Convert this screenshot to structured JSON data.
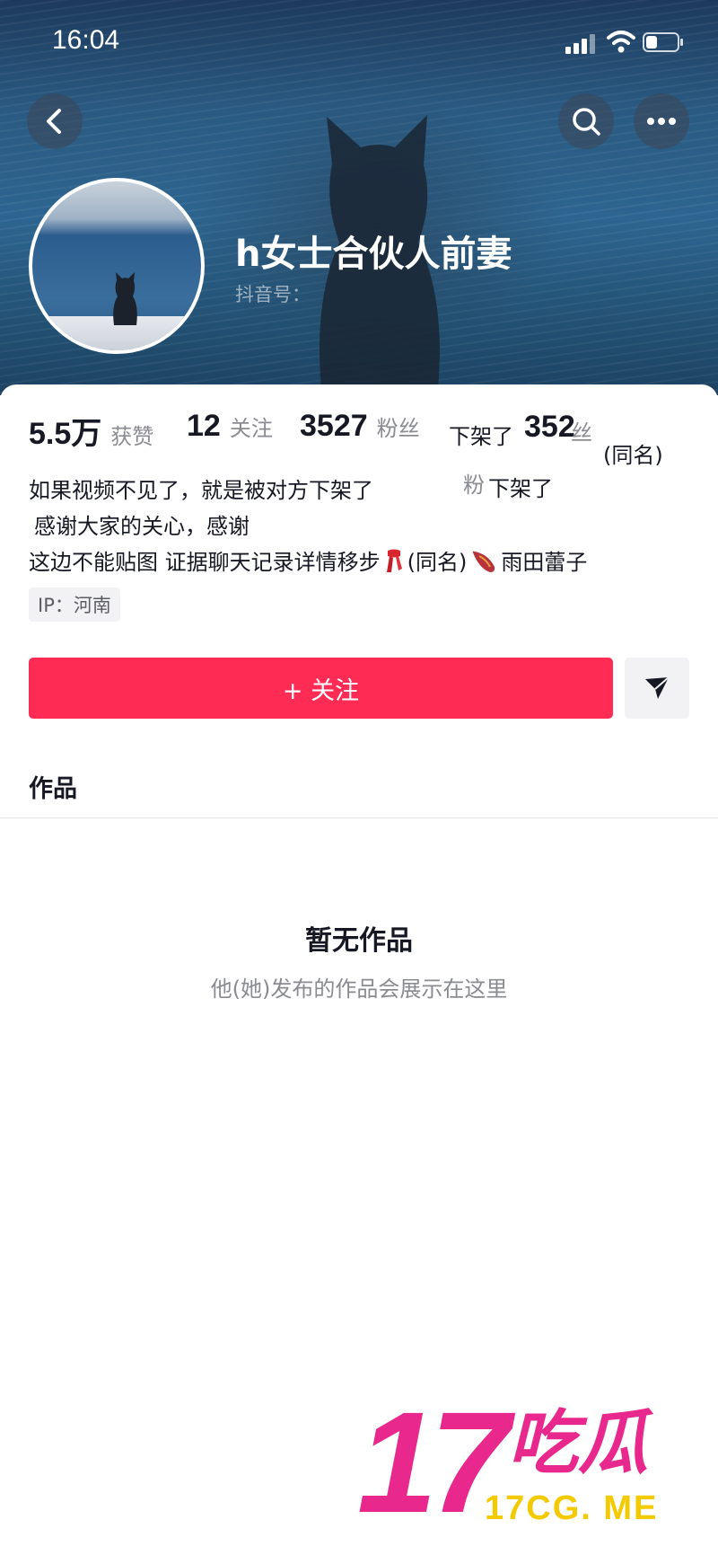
{
  "status_bar": {
    "time": "16:04"
  },
  "profile": {
    "nickname": "h女士合伙人前妻",
    "douyin_id_label": "抖音号："
  },
  "stats": [
    {
      "value": "5.5万",
      "label": "获赞"
    },
    {
      "value": "12",
      "label": "关注"
    },
    {
      "value": "3527",
      "label": "粉丝"
    }
  ],
  "glitch_fragments": [
    "下架了",
    "352",
    "丝",
    "粉",
    "下架了",
    "(同名)"
  ],
  "bio": {
    "line1": "如果视频不见了，就是被对方下架了",
    "line2": "感谢大家的关心，感谢",
    "line3_a": "这边不能贴图 证据聊天记录详情移步",
    "line3_b": "(同名)",
    "line3_c": "雨田蕾子"
  },
  "ip_location": "IP：河南",
  "actions": {
    "follow_label": "+ 关注"
  },
  "tabs": {
    "works": "作品"
  },
  "empty_state": {
    "title": "暂无作品",
    "subtitle": "他(她)发布的作品会展示在这里"
  },
  "watermark": {
    "number": "17",
    "text": "吃瓜",
    "url": "17CG. ME"
  },
  "colors": {
    "accent": "#fe2c55",
    "watermark_pink": "#e8288c",
    "watermark_yellow": "#f3c900"
  },
  "icons": [
    "back-arrow-icon",
    "search-icon",
    "more-icon",
    "share-send-icon",
    "signal-icon",
    "wifi-icon",
    "battery-icon"
  ]
}
